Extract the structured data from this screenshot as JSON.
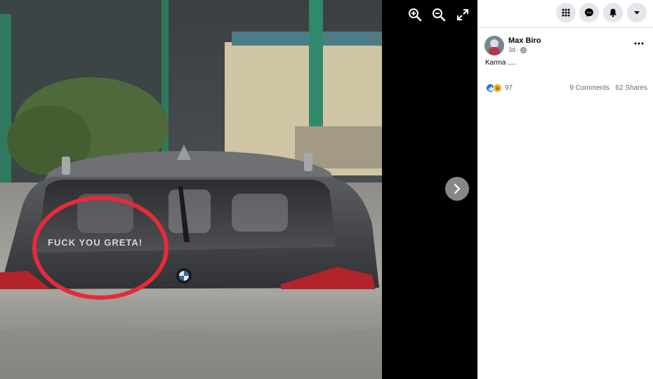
{
  "post": {
    "author": "Max Biro",
    "time": "3d",
    "text": "Karma ....",
    "reaction_count": "97",
    "comments": "9 Comments",
    "shares": "62 Shares"
  },
  "photo": {
    "sticker_text": "FUCK YOU GRETA!"
  },
  "colors": {
    "accent": "#1877f2",
    "annotation_ring": "#e52b3b",
    "viewer_bg": "#000000"
  }
}
